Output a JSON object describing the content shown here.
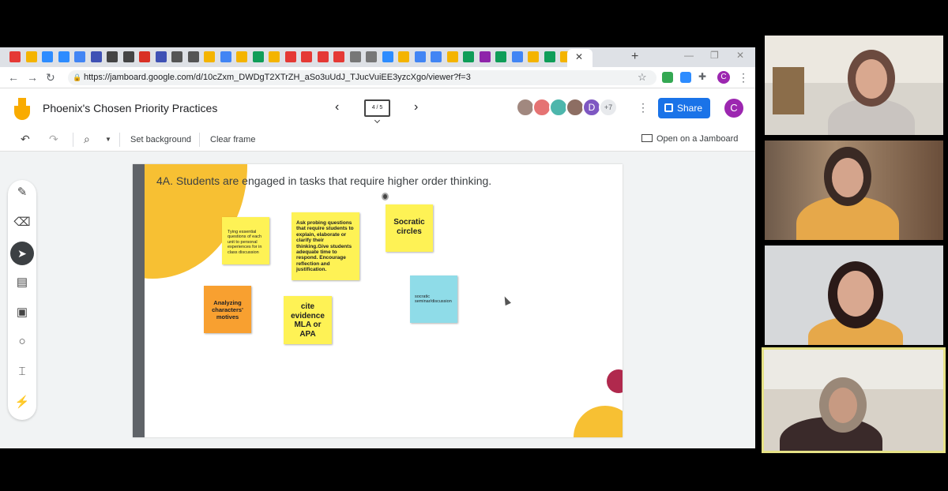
{
  "browser": {
    "url": "https://jamboard.google.com/d/10cZxm_DWDgT2XTrZH_aSo3uUdJ_TJucVuiEE3yzcXgo/viewer?f=3",
    "tab_icons": [
      "youtube-icon",
      "slides-icon",
      "zoom-icon",
      "zoom-icon",
      "docs-icon",
      "c-icon",
      "e-icon",
      "e-icon",
      "gmail-icon",
      "c-icon",
      "link-icon",
      "link-icon",
      "slides-icon",
      "g-icon",
      "slides-icon",
      "drive-icon",
      "slides-icon",
      "youtube-icon",
      "youtube-icon",
      "youtube-icon",
      "youtube-icon",
      "n-icon",
      "n-icon",
      "zoom-icon",
      "slides-icon",
      "docs-icon",
      "docs-icon",
      "slides-icon",
      "drive-icon",
      "photo-icon",
      "drive-icon",
      "docs-icon",
      "slides-icon",
      "drive-icon",
      "slides-icon"
    ],
    "profile_initial": "C"
  },
  "jamboard": {
    "title": "Phoenix's Chosen Priority Practices",
    "frame_indicator": "4 / 5",
    "collaborators_extra": "+7",
    "collaborator_d_initial": "D",
    "share_label": "Share",
    "profile_initial": "C"
  },
  "toolbar": {
    "set_background": "Set background",
    "clear_frame": "Clear frame",
    "open_on_jamboard": "Open on a Jamboard"
  },
  "frame": {
    "heading": "4A. Students are engaged in tasks that require higher order thinking.",
    "stickies": [
      {
        "text": "Tying essential questions of each unit to personal experiences for in class discussion",
        "color": "#fef255"
      },
      {
        "text": "Ask probing questions that require students to explain, elaborate or clarify their thinking.Give students adequate time to respond. Encourage reflection and justification.",
        "color": "#fef255"
      },
      {
        "text": "Socratic circles",
        "color": "#fef255"
      },
      {
        "text": "Analyzing characters' motives",
        "color": "#f8a030"
      },
      {
        "text": "cite evidence MLA or APA",
        "color": "#fef255"
      },
      {
        "text": "socratic seminar/discussion",
        "color": "#8fdce8"
      }
    ]
  },
  "colors": {
    "share_blue": "#1a73e8",
    "accent_yellow": "#f7c033",
    "accent_red": "#b0294d",
    "profile_purple": "#9c27b0"
  }
}
